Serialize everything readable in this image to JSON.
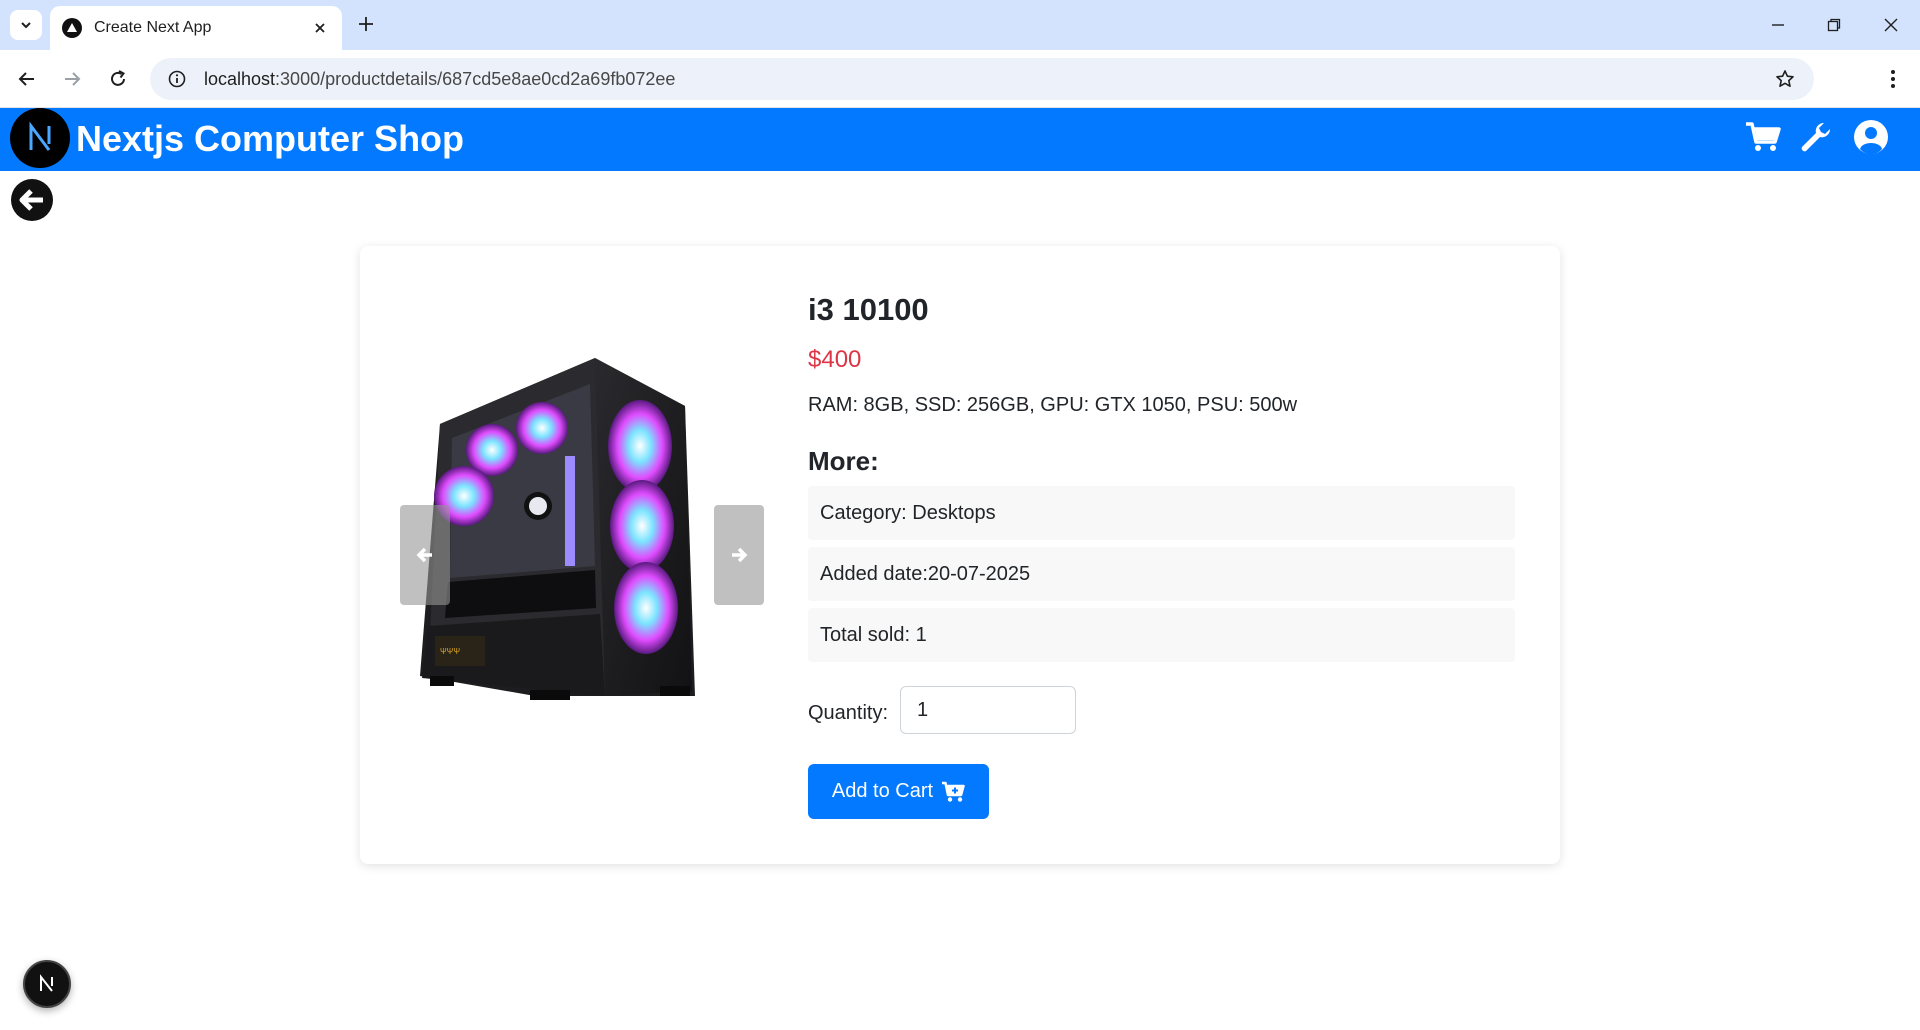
{
  "browser": {
    "tab_title": "Create Next App",
    "url_host": "localhost",
    "url_path": ":3000/productdetails/687cd5e8ae0cd2a69fb072ee"
  },
  "site": {
    "brand": "Nextjs Computer Shop",
    "logo_letter": "N"
  },
  "product": {
    "title": "i3 10100",
    "price": "$400",
    "description": "RAM: 8GB, SSD: 256GB, GPU: GTX 1050, PSU: 500w",
    "more_heading": "More:",
    "details": [
      "Category: Desktops",
      "Added date:20-07-2025",
      "Total sold: 1"
    ],
    "quantity_label": "Quantity:",
    "quantity_value": "1",
    "add_to_cart_label": "Add to Cart"
  },
  "dev_badge_letter": "N",
  "colors": {
    "accent": "#0379ff",
    "price": "#dc3545",
    "tabbar": "#d3e3fd"
  }
}
